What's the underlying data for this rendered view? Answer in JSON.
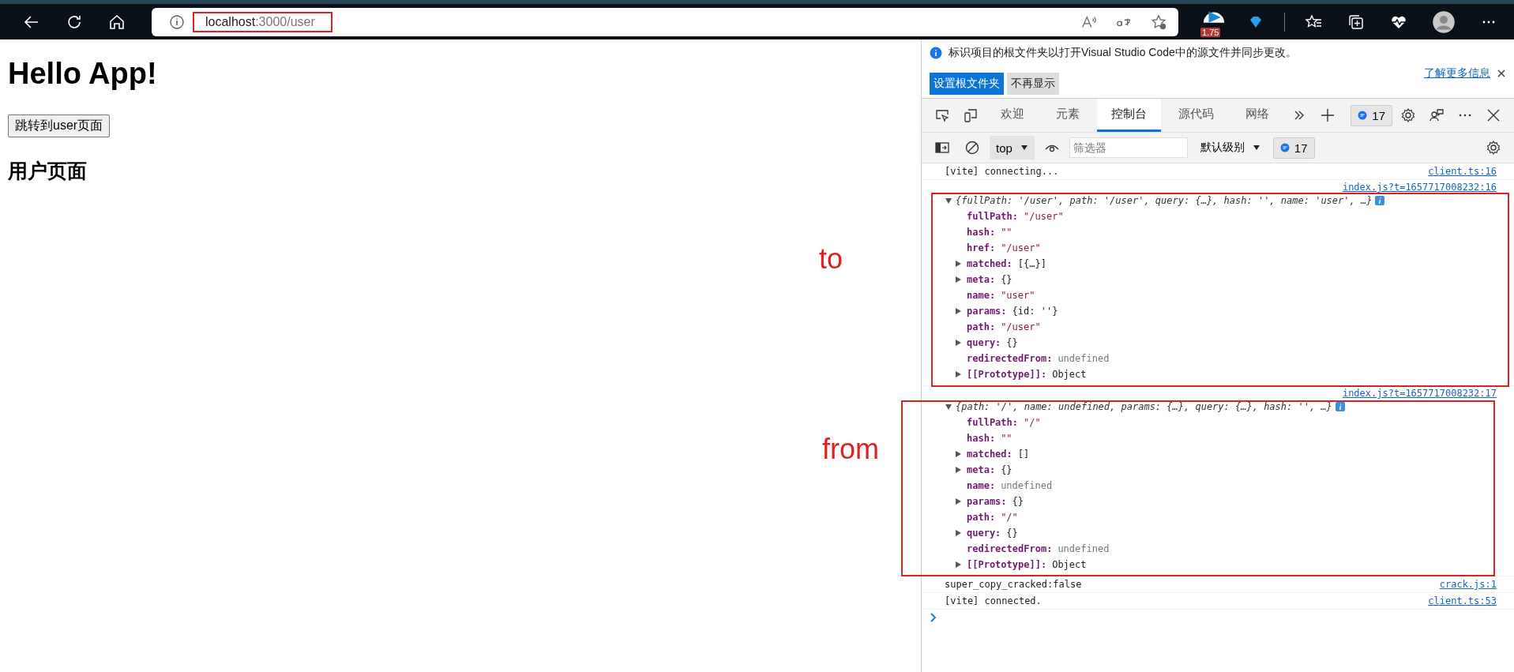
{
  "browser": {
    "url_host": "localhost",
    "url_path": ":3000/user",
    "extension_badge": "1.75"
  },
  "page": {
    "title": "Hello App!",
    "button": "跳转到user页面",
    "subtitle": "用户页面"
  },
  "devtools": {
    "infobar": {
      "message": "标识项目的根文件夹以打开Visual Studio Code中的源文件并同步更改。",
      "primary_button": "设置根文件夹",
      "secondary_button": "不再显示",
      "link": "了解更多信息"
    },
    "tabs": [
      {
        "label": "欢迎",
        "selected": false
      },
      {
        "label": "元素",
        "selected": false
      },
      {
        "label": "控制台",
        "selected": true
      },
      {
        "label": "源代码",
        "selected": false
      },
      {
        "label": "网络",
        "selected": false
      }
    ],
    "issues_count": "17",
    "console_toolbar": {
      "context": "top",
      "filter_placeholder": "筛选器",
      "level": "默认级别",
      "issues_count": "17"
    },
    "console": [
      {
        "kind": "log",
        "text": "[vite] connecting...",
        "source": "client.ts:16"
      },
      {
        "kind": "object",
        "source": "index.js?t=1657717008232:16",
        "summary": "{fullPath: '/user', path: '/user', query: {…}, hash: '', name: 'user', …}",
        "expanded": true,
        "annotation": "to",
        "props": [
          {
            "key": "fullPath:",
            "value": "\"/user\"",
            "kind": "string",
            "expandable": false
          },
          {
            "key": "hash:",
            "value": "\"\"",
            "kind": "string",
            "expandable": false
          },
          {
            "key": "href:",
            "value": "\"/user\"",
            "kind": "string",
            "expandable": false
          },
          {
            "key": "matched:",
            "value": "[{…}]",
            "kind": "object",
            "expandable": true
          },
          {
            "key": "meta:",
            "value": "{}",
            "kind": "object",
            "expandable": true
          },
          {
            "key": "name:",
            "value": "\"user\"",
            "kind": "string",
            "expandable": false
          },
          {
            "key": "params:",
            "value": "{id: ''}",
            "kind": "object",
            "expandable": true
          },
          {
            "key": "path:",
            "value": "\"/user\"",
            "kind": "string",
            "expandable": false
          },
          {
            "key": "query:",
            "value": "{}",
            "kind": "object",
            "expandable": true
          },
          {
            "key": "redirectedFrom:",
            "value": "undefined",
            "kind": "undefined",
            "expandable": false
          },
          {
            "key": "[[Prototype]]:",
            "value": "Object",
            "kind": "object",
            "expandable": true
          }
        ]
      },
      {
        "kind": "object",
        "source": "index.js?t=1657717008232:17",
        "summary": "{path: '/', name: undefined, params: {…}, query: {…}, hash: '', …}",
        "expanded": true,
        "annotation": "from",
        "props": [
          {
            "key": "fullPath:",
            "value": "\"/\"",
            "kind": "string",
            "expandable": false
          },
          {
            "key": "hash:",
            "value": "\"\"",
            "kind": "string",
            "expandable": false
          },
          {
            "key": "matched:",
            "value": "[]",
            "kind": "object",
            "expandable": true
          },
          {
            "key": "meta:",
            "value": "{}",
            "kind": "object",
            "expandable": true
          },
          {
            "key": "name:",
            "value": "undefined",
            "kind": "undefined",
            "expandable": false
          },
          {
            "key": "params:",
            "value": "{}",
            "kind": "object",
            "expandable": true
          },
          {
            "key": "path:",
            "value": "\"/\"",
            "kind": "string",
            "expandable": false
          },
          {
            "key": "query:",
            "value": "{}",
            "kind": "object",
            "expandable": true
          },
          {
            "key": "redirectedFrom:",
            "value": "undefined",
            "kind": "undefined",
            "expandable": false
          },
          {
            "key": "[[Prototype]]:",
            "value": "Object",
            "kind": "object",
            "expandable": true
          }
        ]
      },
      {
        "kind": "log",
        "text": "super_copy_cracked:false",
        "source": "crack.js:1"
      },
      {
        "kind": "log",
        "text": "[vite] connected.",
        "source": "client.ts:53"
      }
    ]
  }
}
